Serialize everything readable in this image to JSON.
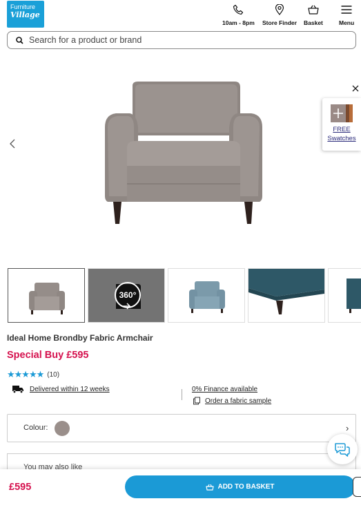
{
  "header": {
    "logo_line1": "Furniture",
    "logo_line2": "Village",
    "phone_label": "10am - 8pm",
    "store_label": "Store Finder",
    "basket_label": "Basket",
    "menu_label": "Menu"
  },
  "search": {
    "placeholder": "Search for a product or brand"
  },
  "swatches": {
    "line1": "FREE",
    "line2": "Swatches"
  },
  "thumbnails": {
    "badge_360": "360°"
  },
  "product": {
    "title": "Ideal Home Brondby Fabric Armchair",
    "price_label": "Special Buy £595",
    "rating_stars": "★★★★★",
    "rating_value": 5,
    "review_count": "(10)"
  },
  "links": {
    "delivery": "Delivered within 12 weeks",
    "finance": "0% Finance available",
    "sample": "Order a fabric sample"
  },
  "colour": {
    "label": "Colour:",
    "swatch_color": "#9a8f8b"
  },
  "also": {
    "label": "You may also like"
  },
  "footer": {
    "price": "£595",
    "add_label": "ADD TO BASKET"
  },
  "colors": {
    "brand": "#1aa0d8",
    "accent": "#1b9ad6",
    "price": "#d5114e"
  }
}
